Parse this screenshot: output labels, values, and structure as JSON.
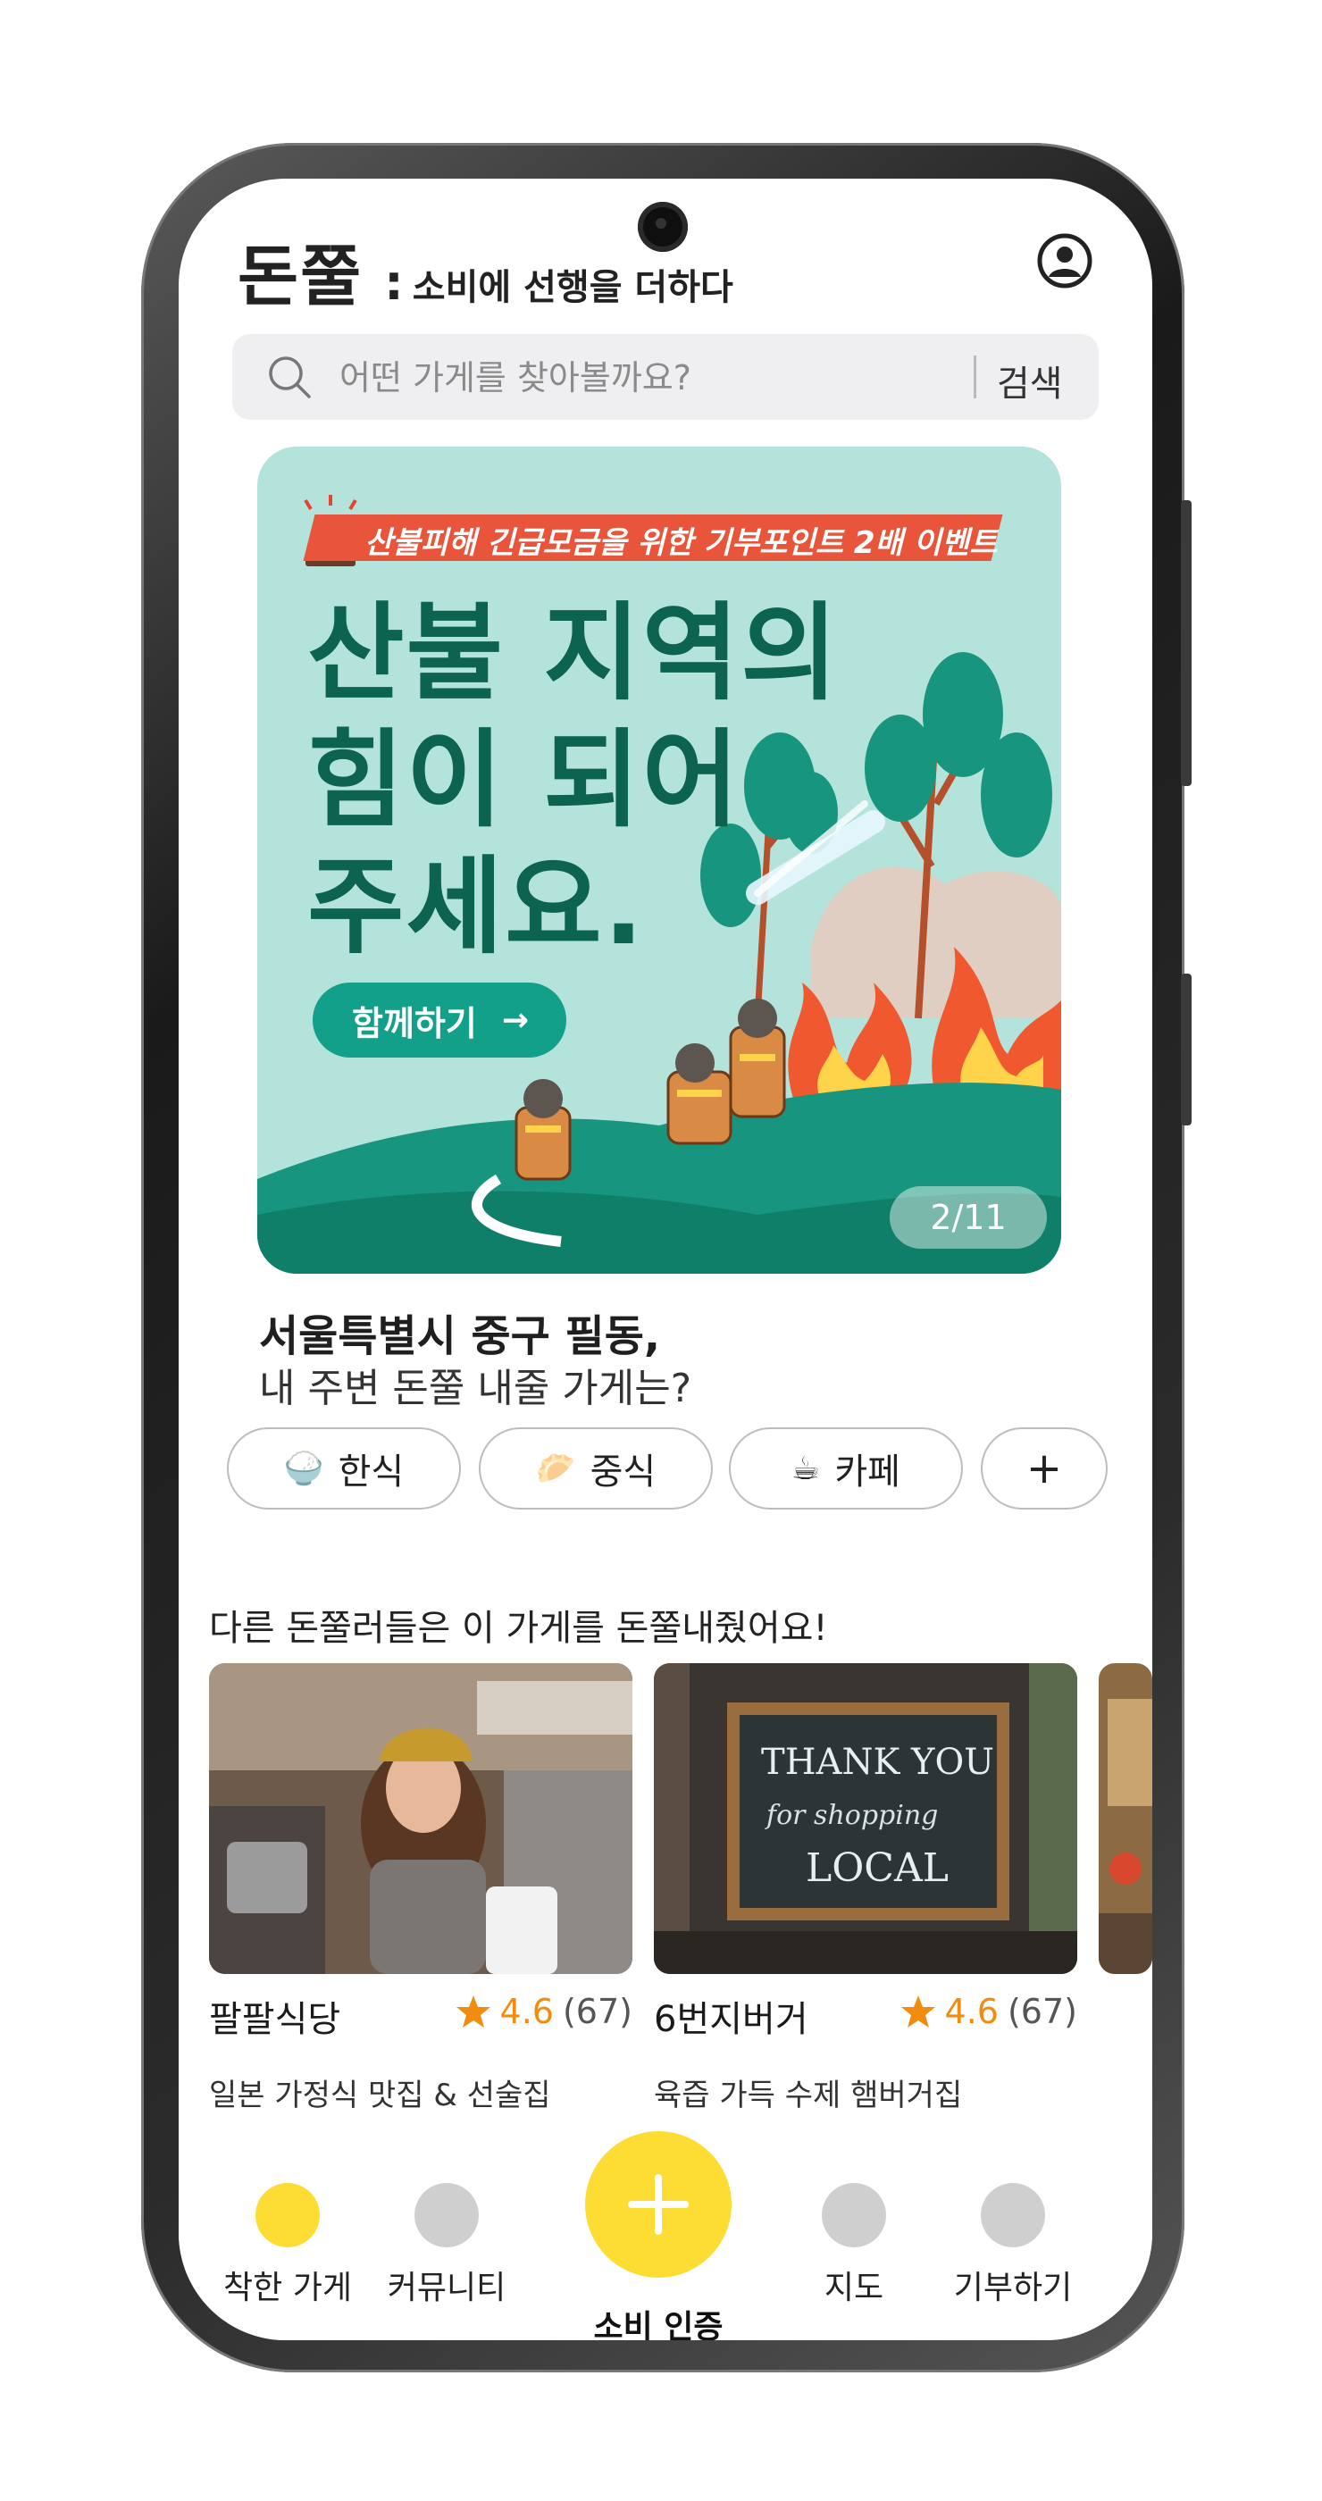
{
  "header": {
    "brand_name": "돈쭐",
    "brand_colon": ":",
    "tagline": "소비에 선행을 더하다"
  },
  "search": {
    "placeholder": "어떤 가게를 찾아볼까요?",
    "button_label": "검색"
  },
  "banner": {
    "event_text": "산불피해 긴급모금을 위한  기부포인트 2배 이벤트",
    "headline_line1": "산불 지역의",
    "headline_line2": "힘이 되어",
    "headline_line3": "주세요.",
    "cta_label": "함께하기",
    "cta_arrow": "→",
    "counter": "2/11"
  },
  "location": {
    "line1": "서울특별시 중구 필동,",
    "line2": "내 주변 돈쭐 내줄 가게는?"
  },
  "categories": [
    {
      "emoji": "🍚",
      "label": "한식"
    },
    {
      "emoji": "🥟",
      "label": "중식"
    },
    {
      "emoji": "☕",
      "label": "카페"
    },
    {
      "emoji": "",
      "label": "+"
    }
  ],
  "section": {
    "title": "다른 돈쭐러들은 이 가게를 돈쭐내줬어요!"
  },
  "stores": [
    {
      "name": "팔팔식당",
      "rating": "4.6",
      "count": "(67)",
      "desc": "일본 가정식 맛집 & 선술집"
    },
    {
      "name": "6번지버거",
      "rating": "4.6",
      "count": "(67)",
      "desc": "육즙 가득 수제 햄버거집"
    }
  ],
  "sign_text": {
    "line1": "THANK YOU",
    "line2": "for shopping",
    "line3": "LOCAL"
  },
  "nav": {
    "items": [
      {
        "label": "착한 가게"
      },
      {
        "label": "커뮤니티"
      },
      {
        "label": "소비 인증"
      },
      {
        "label": "지도"
      },
      {
        "label": "기부하기"
      }
    ],
    "fab_symbol": "+"
  },
  "colors": {
    "accent_yellow": "#fddc34",
    "banner_bg": "#b4e3dc",
    "banner_green": "#0c6350",
    "cta_green": "#12a08a",
    "ribbon_red": "#e9553a",
    "star_orange": "#f28c0f"
  }
}
